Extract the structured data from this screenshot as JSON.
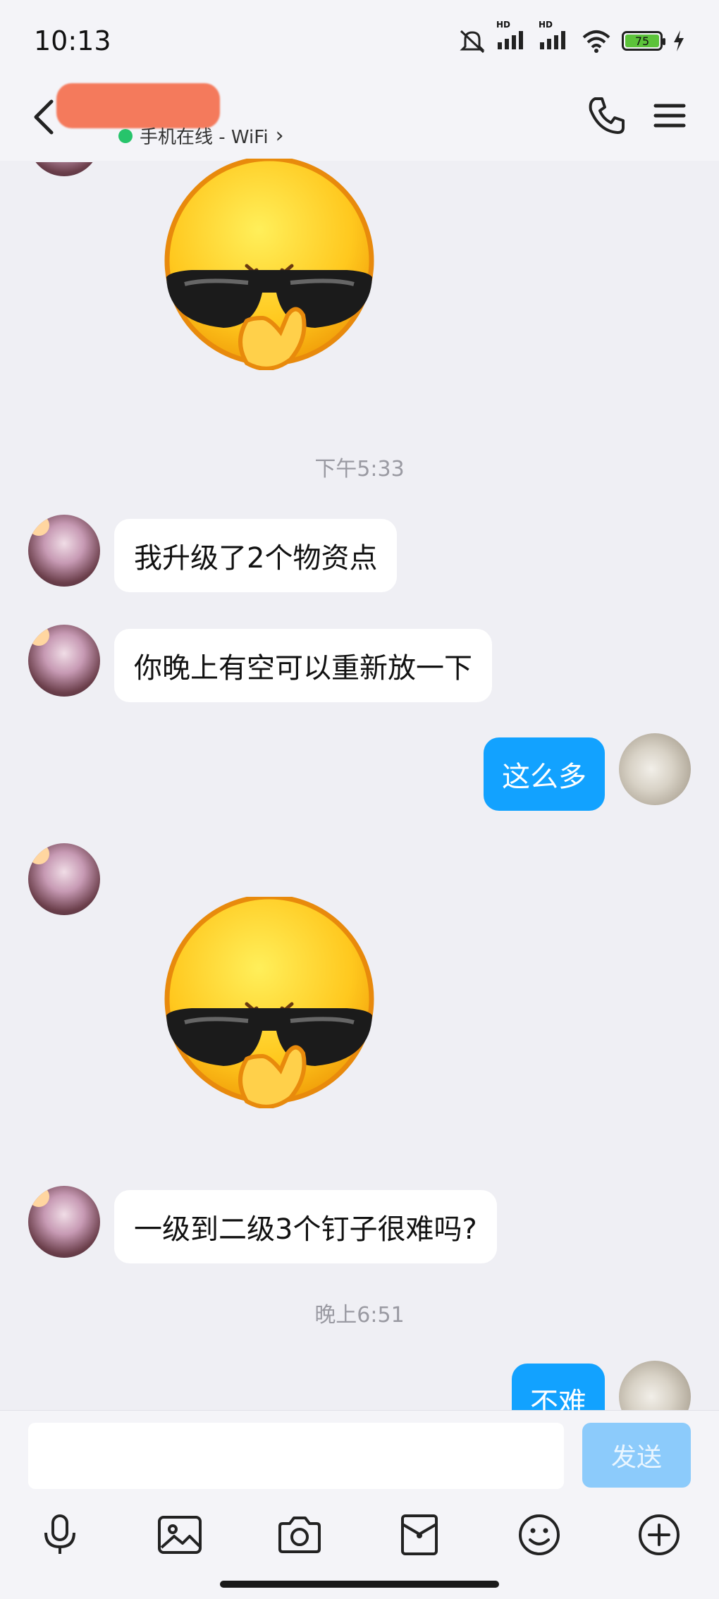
{
  "status_bar": {
    "time": "10:13",
    "signal1_label": "HD",
    "signal2_label": "HD",
    "battery_level": "75"
  },
  "header": {
    "presence_text": "手机在线 - WiFi",
    "presence_chevron": "›"
  },
  "messages": {
    "ts1": "下午5:33",
    "m1": "我升级了2个物资点",
    "m2": "你晚上有空可以重新放一下",
    "m3": "这么多",
    "m4": "一级到二级3个钉子很难吗?",
    "ts2": "晚上6:51",
    "m5": "不难"
  },
  "input": {
    "placeholder": "",
    "send_label": "发送"
  },
  "colors": {
    "accent": "#12a2ff",
    "online": "#27c46b",
    "send_disabled": "#8ccbfb"
  }
}
